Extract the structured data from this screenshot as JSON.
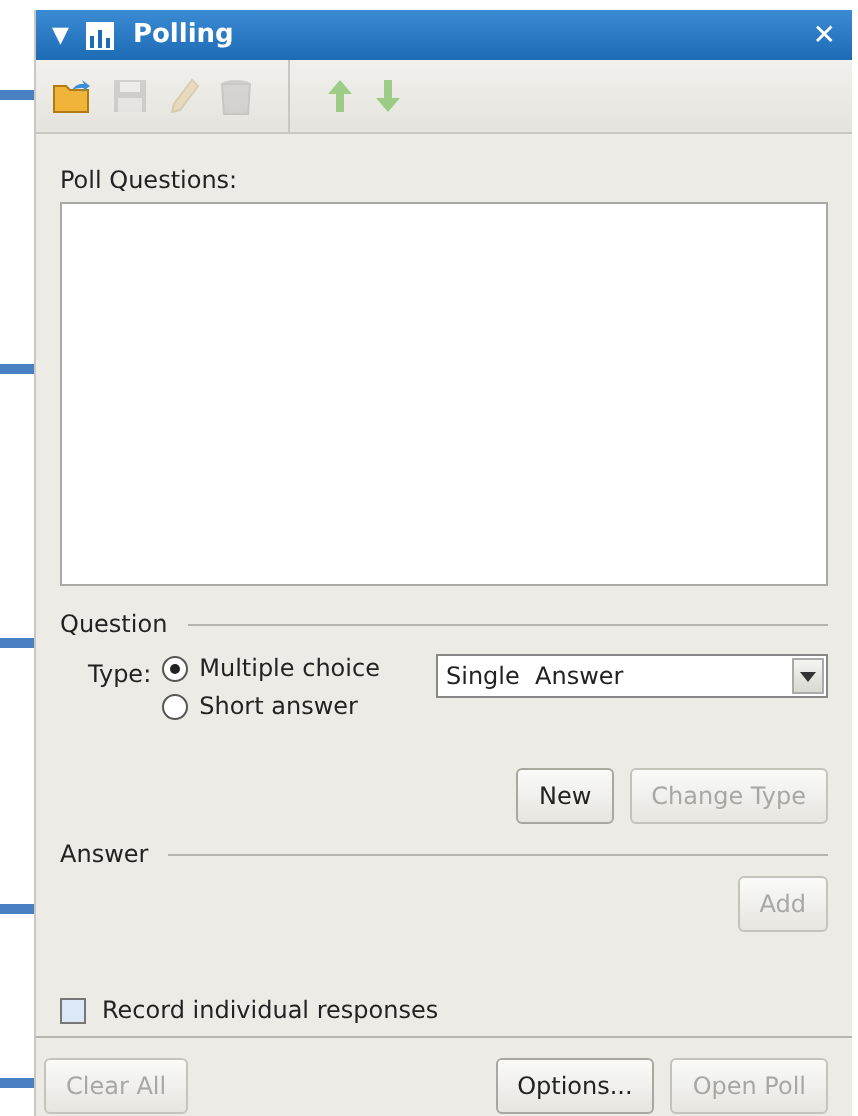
{
  "window": {
    "title": "Polling",
    "collapse_glyph": "▼",
    "close_glyph": "✕"
  },
  "toolbar": [
    {
      "kind": "open",
      "disabled": false
    },
    {
      "kind": "save",
      "disabled": true
    },
    {
      "kind": "edit",
      "disabled": true
    },
    {
      "kind": "delete",
      "disabled": true
    },
    {
      "kind": "separator"
    },
    {
      "kind": "up",
      "disabled": true
    },
    {
      "kind": "down",
      "disabled": true
    }
  ],
  "questions_label": "Poll Questions:",
  "question_section": {
    "title": "Question",
    "type_label": "Type:",
    "types": [
      {
        "label": "Multiple choice",
        "selected": true
      },
      {
        "label": "Short answer",
        "selected": false
      }
    ],
    "answer_mode": "Single  Answer",
    "buttons": [
      {
        "label": "New",
        "disabled": false
      },
      {
        "label": "Change Type",
        "disabled": true
      }
    ]
  },
  "answer_section": {
    "title": "Answer",
    "buttons": [
      {
        "label": "Add",
        "disabled": true
      }
    ]
  },
  "record_responses": {
    "label": "Record individual responses",
    "checked": false
  },
  "footer": {
    "left": [
      {
        "label": "Clear All",
        "disabled": true
      }
    ],
    "right": [
      {
        "label": "Options...",
        "disabled": false
      },
      {
        "label": "Open Poll",
        "disabled": true
      }
    ]
  }
}
